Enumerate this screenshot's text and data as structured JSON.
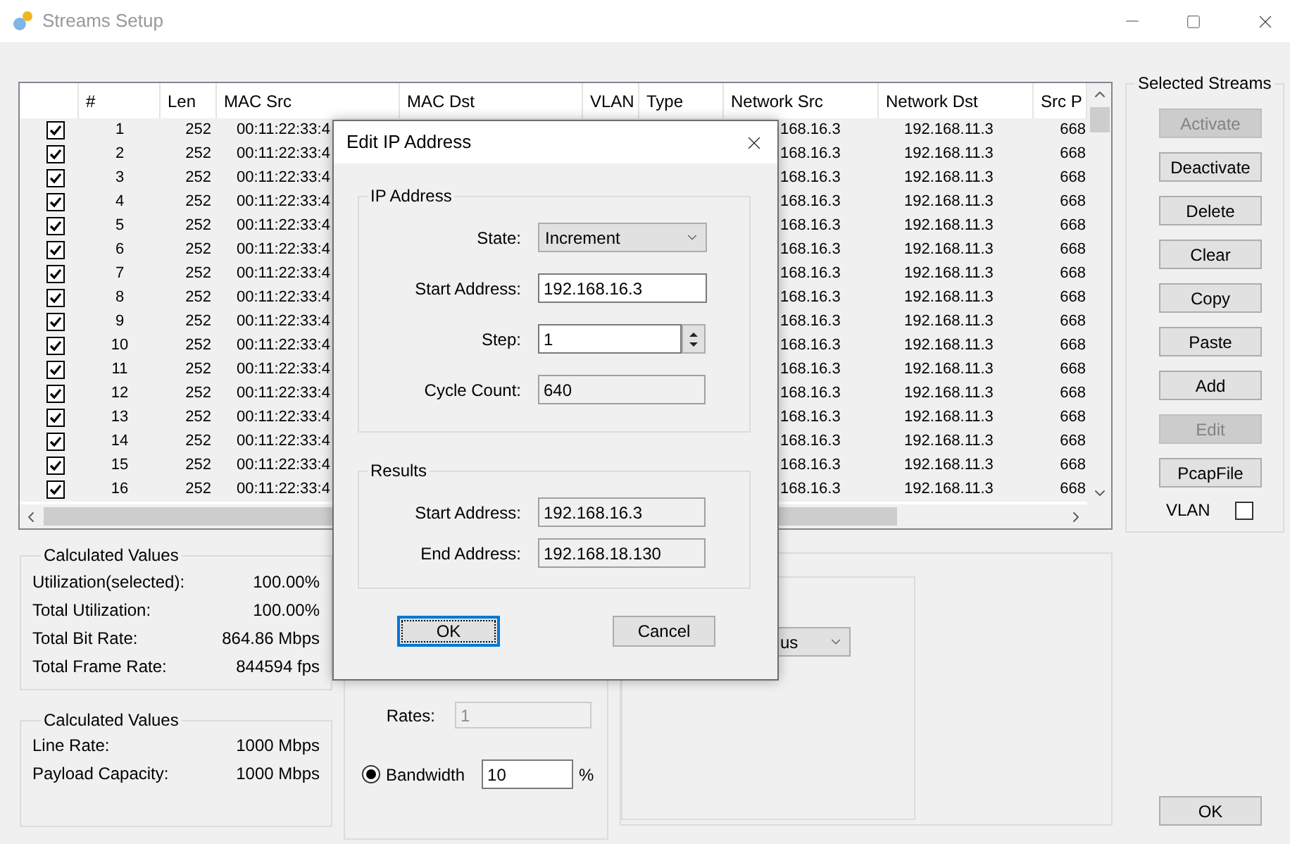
{
  "window": {
    "title": "Streams Setup"
  },
  "table": {
    "columns": [
      "#",
      "Len",
      "MAC Src",
      "MAC Dst",
      "VLAN",
      "Type",
      "Network Src",
      "Network Dst",
      "Src P"
    ],
    "rows": [
      {
        "checked": true,
        "selected": true,
        "number": "1",
        "len": "252",
        "mac_src": "00:11:22:33:4",
        "network_src": "168.16.3",
        "network_dst": "192.168.11.3",
        "src_port": "668"
      },
      {
        "checked": true,
        "selected": true,
        "number": "2",
        "len": "252",
        "mac_src": "00:11:22:33:4",
        "network_src": "168.16.3",
        "network_dst": "192.168.11.3",
        "src_port": "668"
      },
      {
        "checked": true,
        "selected": true,
        "number": "3",
        "len": "252",
        "mac_src": "00:11:22:33:4",
        "network_src": "168.16.3",
        "network_dst": "192.168.11.3",
        "src_port": "668"
      },
      {
        "checked": true,
        "selected": true,
        "number": "4",
        "len": "252",
        "mac_src": "00:11:22:33:4",
        "network_src": "168.16.3",
        "network_dst": "192.168.11.3",
        "src_port": "668"
      },
      {
        "checked": true,
        "selected": true,
        "number": "5",
        "len": "252",
        "mac_src": "00:11:22:33:4",
        "network_src": "168.16.3",
        "network_dst": "192.168.11.3",
        "src_port": "668"
      },
      {
        "checked": true,
        "selected": true,
        "number": "6",
        "len": "252",
        "mac_src": "00:11:22:33:4",
        "network_src": "168.16.3",
        "network_dst": "192.168.11.3",
        "src_port": "668"
      },
      {
        "checked": true,
        "selected": true,
        "number": "7",
        "len": "252",
        "mac_src": "00:11:22:33:4",
        "network_src": "168.16.3",
        "network_dst": "192.168.11.3",
        "src_port": "668"
      },
      {
        "checked": true,
        "selected": true,
        "number": "8",
        "len": "252",
        "mac_src": "00:11:22:33:4",
        "network_src": "168.16.3",
        "network_dst": "192.168.11.3",
        "src_port": "668"
      },
      {
        "checked": true,
        "selected": true,
        "number": "9",
        "len": "252",
        "mac_src": "00:11:22:33:4",
        "network_src": "168.16.3",
        "network_dst": "192.168.11.3",
        "src_port": "668"
      },
      {
        "checked": true,
        "selected": true,
        "number": "10",
        "len": "252",
        "mac_src": "00:11:22:33:4",
        "network_src": "168.16.3",
        "network_dst": "192.168.11.3",
        "src_port": "668"
      },
      {
        "checked": true,
        "selected": true,
        "number": "11",
        "len": "252",
        "mac_src": "00:11:22:33:4",
        "network_src": "168.16.3",
        "network_dst": "192.168.11.3",
        "src_port": "668"
      },
      {
        "checked": true,
        "selected": true,
        "number": "12",
        "len": "252",
        "mac_src": "00:11:22:33:4",
        "network_src": "168.16.3",
        "network_dst": "192.168.11.3",
        "src_port": "668"
      },
      {
        "checked": true,
        "selected": true,
        "number": "13",
        "len": "252",
        "mac_src": "00:11:22:33:4",
        "network_src": "168.16.3",
        "network_dst": "192.168.11.3",
        "src_port": "668"
      },
      {
        "checked": true,
        "selected": true,
        "number": "14",
        "len": "252",
        "mac_src": "00:11:22:33:4",
        "network_src": "168.16.3",
        "network_dst": "192.168.11.3",
        "src_port": "668"
      },
      {
        "checked": true,
        "selected": true,
        "number": "15",
        "len": "252",
        "mac_src": "00:11:22:33:4",
        "network_src": "168.16.3",
        "network_dst": "192.168.11.3",
        "src_port": "668"
      },
      {
        "checked": true,
        "selected": true,
        "number": "16",
        "len": "252",
        "mac_src": "00:11:22:33:4",
        "network_src": "168.16.3",
        "network_dst": "192.168.11.3",
        "src_port": "668"
      }
    ]
  },
  "selected_streams": {
    "title": "Selected Streams",
    "buttons": [
      {
        "label": "Activate",
        "disabled": true
      },
      {
        "label": "Deactivate",
        "disabled": false
      },
      {
        "label": "Delete",
        "disabled": false
      },
      {
        "label": "Clear",
        "disabled": false
      },
      {
        "label": "Copy",
        "disabled": false
      },
      {
        "label": "Paste",
        "disabled": false
      },
      {
        "label": "Add",
        "disabled": false
      },
      {
        "label": "Edit",
        "disabled": true
      },
      {
        "label": "PcapFile",
        "disabled": false
      }
    ],
    "vlan": {
      "label": "VLAN",
      "checked": false
    }
  },
  "calculated_values": [
    {
      "title": "Calculated Values",
      "rows": [
        {
          "label": "Utilization(selected):",
          "value": "100.00%"
        },
        {
          "label": "Total Utilization:",
          "value": "100.00%"
        },
        {
          "label": "Total Bit Rate:",
          "value": "864.86 Mbps"
        },
        {
          "label": "Total Frame Rate:",
          "value": "844594 fps"
        }
      ]
    },
    {
      "title": "Calculated Values",
      "rows": [
        {
          "label": "Line Rate:",
          "value": "1000 Mbps"
        },
        {
          "label": "Payload Capacity:",
          "value": "1000 Mbps"
        }
      ]
    }
  ],
  "rate_panel": {
    "rates": {
      "label": "Rates:",
      "value": "1",
      "disabled": true
    },
    "bandwidth": {
      "label": "Bandwidth",
      "selected": true,
      "value": "10",
      "unit": "%"
    }
  },
  "mode_panel": {
    "dropdown": "us"
  },
  "ok_button": "OK",
  "dialog": {
    "title": "Edit IP Address",
    "ip_group": {
      "title": "IP Address",
      "state": {
        "label": "State:",
        "value": "Increment"
      },
      "start_address": {
        "label": "Start Address:",
        "value": "192.168.16.3"
      },
      "step": {
        "label": "Step:",
        "value": "1"
      },
      "cycle_count": {
        "label": "Cycle Count:",
        "value": "640"
      }
    },
    "results": {
      "title": "Results",
      "start_address": {
        "label": "Start Address:",
        "value": "192.168.16.3"
      },
      "end_address": {
        "label": "End Address:",
        "value": "192.168.18.130"
      }
    },
    "buttons": [
      {
        "label": "OK",
        "focused": true
      },
      {
        "label": "Cancel",
        "focused": false
      }
    ]
  }
}
